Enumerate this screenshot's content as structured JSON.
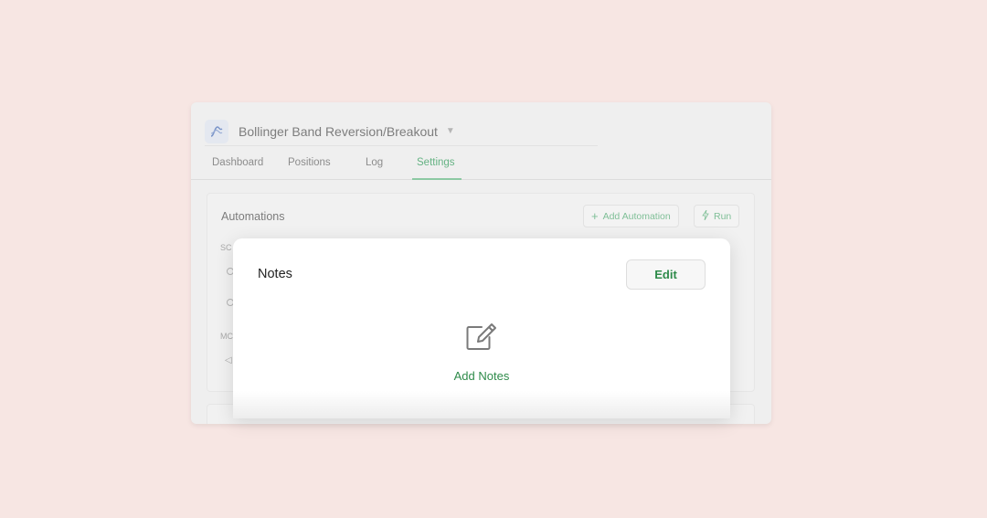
{
  "app": {
    "title": "Bollinger Band Reversion/Breakout",
    "logo_icon": "chart-wave-icon"
  },
  "tabs": [
    {
      "label": "Dashboard",
      "active": false
    },
    {
      "label": "Positions",
      "active": false
    },
    {
      "label": "Log",
      "active": false
    },
    {
      "label": "Settings",
      "active": true
    }
  ],
  "automations": {
    "title": "Automations",
    "add_label": "Add Automation",
    "run_label": "Run",
    "section1_label": "SC",
    "section2_label": "MC"
  },
  "notes_modal": {
    "title": "Notes",
    "edit_label": "Edit",
    "add_label": "Add Notes",
    "icon": "edit-note-icon"
  },
  "colors": {
    "accent": "#2e8b4a",
    "background": "#f7e6e3"
  }
}
